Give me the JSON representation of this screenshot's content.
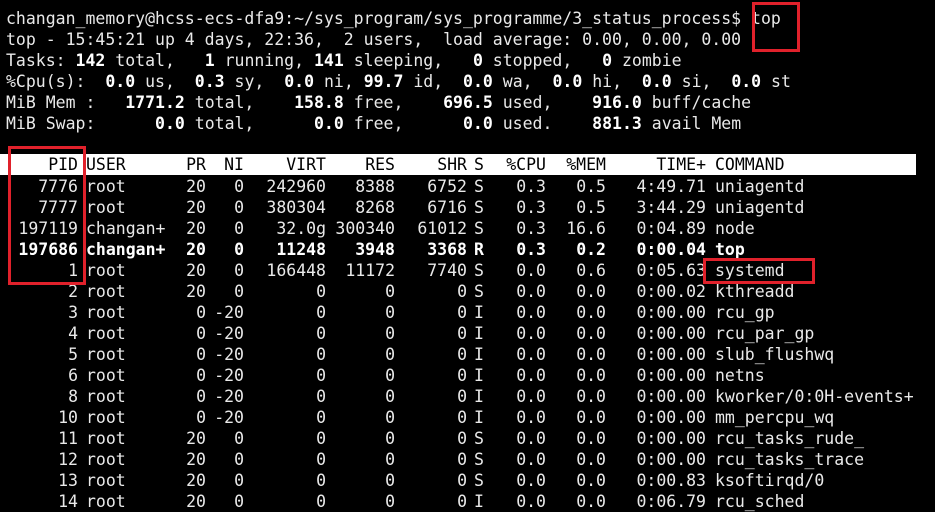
{
  "terminal": {
    "prompt": "changan_memory@hcss-ecs-dfa9:~/sys_program/sys_programme/3_status_process$ ",
    "command": "top"
  },
  "summary": {
    "uptime_line": "top - 15:45:21 up 4 days, 22:36,  2 users,  load average: 0.00, 0.00, 0.00",
    "tasks": {
      "label": "Tasks:",
      "total": "142",
      "running": "1",
      "sleeping": "141",
      "stopped": "0",
      "zombie": "0"
    },
    "cpu": {
      "label": "%Cpu(s):",
      "us": "0.0",
      "sy": "0.3",
      "ni": "0.0",
      "id": "99.7",
      "wa": "0.0",
      "hi": "0.0",
      "si": "0.0",
      "st": "0.0"
    },
    "mem": {
      "label": "MiB Mem :",
      "total": "1771.2",
      "free": "158.8",
      "used": "696.5",
      "buff_cache": "916.0"
    },
    "swap": {
      "label": "MiB Swap:",
      "total": "0.0",
      "free": "0.0",
      "used": "0.0",
      "avail_mem": "881.3"
    }
  },
  "table": {
    "columns": [
      "PID",
      "USER",
      "PR",
      "NI",
      "VIRT",
      "RES",
      "SHR",
      "S",
      "%CPU",
      "%MEM",
      "TIME+",
      "COMMAND"
    ],
    "rows": [
      {
        "pid": "7776",
        "user": "root",
        "pr": "20",
        "ni": "0",
        "virt": "242960",
        "res": "8388",
        "shr": "6752",
        "s": "S",
        "cpu": "0.3",
        "mem": "0.5",
        "time": "4:49.71",
        "command": "uniagentd"
      },
      {
        "pid": "7777",
        "user": "root",
        "pr": "20",
        "ni": "0",
        "virt": "380304",
        "res": "8268",
        "shr": "6716",
        "s": "S",
        "cpu": "0.3",
        "mem": "0.5",
        "time": "3:44.29",
        "command": "uniagentd"
      },
      {
        "pid": "197119",
        "user": "changan+",
        "pr": "20",
        "ni": "0",
        "virt": "32.0g",
        "res": "300340",
        "shr": "61012",
        "s": "S",
        "cpu": "0.3",
        "mem": "16.6",
        "time": "0:04.89",
        "command": "node"
      },
      {
        "pid": "197686",
        "user": "changan+",
        "pr": "20",
        "ni": "0",
        "virt": "11248",
        "res": "3948",
        "shr": "3368",
        "s": "R",
        "cpu": "0.3",
        "mem": "0.2",
        "time": "0:00.04",
        "command": "top",
        "bold": true
      },
      {
        "pid": "1",
        "user": "root",
        "pr": "20",
        "ni": "0",
        "virt": "166448",
        "res": "11172",
        "shr": "7740",
        "s": "S",
        "cpu": "0.0",
        "mem": "0.6",
        "time": "0:05.63",
        "command": "systemd"
      },
      {
        "pid": "2",
        "user": "root",
        "pr": "20",
        "ni": "0",
        "virt": "0",
        "res": "0",
        "shr": "0",
        "s": "S",
        "cpu": "0.0",
        "mem": "0.0",
        "time": "0:00.02",
        "command": "kthreadd"
      },
      {
        "pid": "3",
        "user": "root",
        "pr": "0",
        "ni": "-20",
        "virt": "0",
        "res": "0",
        "shr": "0",
        "s": "I",
        "cpu": "0.0",
        "mem": "0.0",
        "time": "0:00.00",
        "command": "rcu_gp"
      },
      {
        "pid": "4",
        "user": "root",
        "pr": "0",
        "ni": "-20",
        "virt": "0",
        "res": "0",
        "shr": "0",
        "s": "I",
        "cpu": "0.0",
        "mem": "0.0",
        "time": "0:00.00",
        "command": "rcu_par_gp"
      },
      {
        "pid": "5",
        "user": "root",
        "pr": "0",
        "ni": "-20",
        "virt": "0",
        "res": "0",
        "shr": "0",
        "s": "I",
        "cpu": "0.0",
        "mem": "0.0",
        "time": "0:00.00",
        "command": "slub_flushwq"
      },
      {
        "pid": "6",
        "user": "root",
        "pr": "0",
        "ni": "-20",
        "virt": "0",
        "res": "0",
        "shr": "0",
        "s": "I",
        "cpu": "0.0",
        "mem": "0.0",
        "time": "0:00.00",
        "command": "netns"
      },
      {
        "pid": "8",
        "user": "root",
        "pr": "0",
        "ni": "-20",
        "virt": "0",
        "res": "0",
        "shr": "0",
        "s": "I",
        "cpu": "0.0",
        "mem": "0.0",
        "time": "0:00.00",
        "command": "kworker/0:0H-events+"
      },
      {
        "pid": "10",
        "user": "root",
        "pr": "0",
        "ni": "-20",
        "virt": "0",
        "res": "0",
        "shr": "0",
        "s": "I",
        "cpu": "0.0",
        "mem": "0.0",
        "time": "0:00.00",
        "command": "mm_percpu_wq"
      },
      {
        "pid": "11",
        "user": "root",
        "pr": "20",
        "ni": "0",
        "virt": "0",
        "res": "0",
        "shr": "0",
        "s": "S",
        "cpu": "0.0",
        "mem": "0.0",
        "time": "0:00.00",
        "command": "rcu_tasks_rude_"
      },
      {
        "pid": "12",
        "user": "root",
        "pr": "20",
        "ni": "0",
        "virt": "0",
        "res": "0",
        "shr": "0",
        "s": "S",
        "cpu": "0.0",
        "mem": "0.0",
        "time": "0:00.00",
        "command": "rcu_tasks_trace"
      },
      {
        "pid": "13",
        "user": "root",
        "pr": "20",
        "ni": "0",
        "virt": "0",
        "res": "0",
        "shr": "0",
        "s": "S",
        "cpu": "0.0",
        "mem": "0.0",
        "time": "0:00.83",
        "command": "ksoftirqd/0"
      },
      {
        "pid": "14",
        "user": "root",
        "pr": "20",
        "ni": "0",
        "virt": "0",
        "res": "0",
        "shr": "0",
        "s": "I",
        "cpu": "0.0",
        "mem": "0.0",
        "time": "0:06.79",
        "command": "rcu_sched"
      }
    ]
  },
  "colors": {
    "background": "#000000",
    "text": "#e9e9e9",
    "highlight_box": "#e0212b",
    "header_bg": "#ffffff"
  }
}
